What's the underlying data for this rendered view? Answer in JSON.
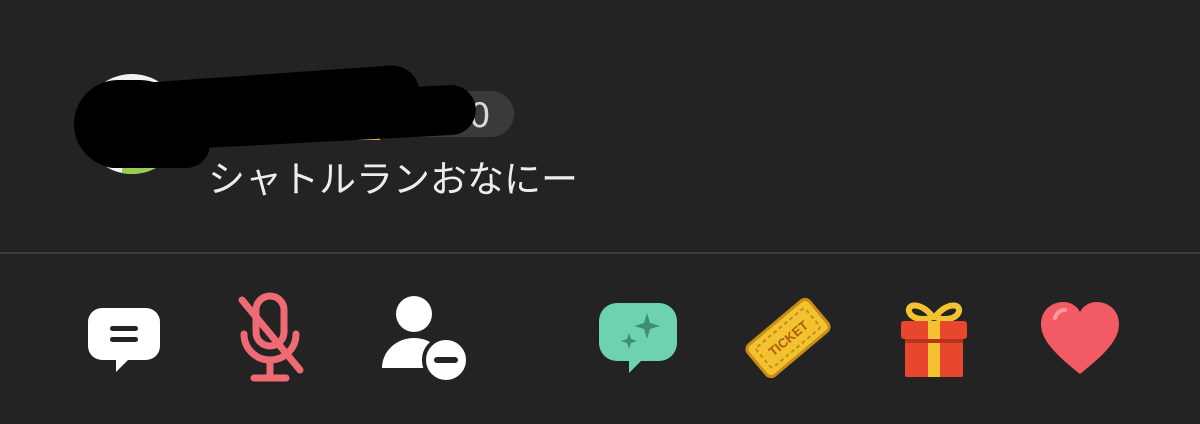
{
  "comment": {
    "level": "Lv.20",
    "text": "シャトルランおなにー"
  },
  "toolbar": {
    "items": [
      {
        "icon": "chat-bubble-icon"
      },
      {
        "icon": "microphone-muted-icon"
      },
      {
        "icon": "remove-user-icon"
      },
      {
        "icon": "sparkle-chat-icon"
      },
      {
        "icon": "ticket-icon",
        "label": "TICKET"
      },
      {
        "icon": "gift-icon"
      },
      {
        "icon": "heart-icon"
      }
    ]
  },
  "colors": {
    "background": "#232323",
    "mic_muted": "#ef6b73",
    "sparkle_chat": "#6fd2ae",
    "ticket": "#f2c230",
    "gift": "#e8472e",
    "heart": "#f25a64"
  }
}
